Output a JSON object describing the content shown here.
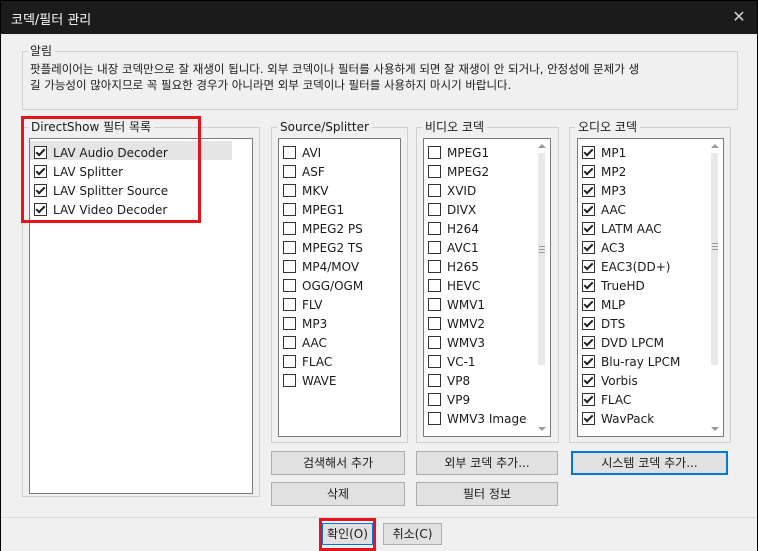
{
  "window": {
    "title": "코덱/필터 관리",
    "close_glyph": "✕"
  },
  "notice": {
    "label": "알림",
    "line1": "팟플레이어는 내장 코덱만으로 잘 재생이 됩니다. 외부 코덱이나 필터를 사용하게 되면 잘 재생이 안 되거나, 안정성에 문제가 생",
    "line2": "길 가능성이 많아지므로 꼭 필요한 경우가 아니라면 외부 코덱이나 필터를 사용하지 마시기 바랍니다."
  },
  "directshow": {
    "label": "DirectShow 필터 목록",
    "items": [
      {
        "label": "LAV Audio Decoder",
        "checked": true
      },
      {
        "label": "LAV Splitter",
        "checked": true
      },
      {
        "label": "LAV Splitter Source",
        "checked": true
      },
      {
        "label": "LAV Video Decoder",
        "checked": true
      }
    ]
  },
  "source": {
    "label": "Source/Splitter",
    "items": [
      {
        "label": "AVI",
        "checked": false
      },
      {
        "label": "ASF",
        "checked": false
      },
      {
        "label": "MKV",
        "checked": false
      },
      {
        "label": "MPEG1",
        "checked": false
      },
      {
        "label": "MPEG2 PS",
        "checked": false
      },
      {
        "label": "MPEG2 TS",
        "checked": false
      },
      {
        "label": "MP4/MOV",
        "checked": false
      },
      {
        "label": "OGG/OGM",
        "checked": false
      },
      {
        "label": "FLV",
        "checked": false
      },
      {
        "label": "MP3",
        "checked": false
      },
      {
        "label": "AAC",
        "checked": false
      },
      {
        "label": "FLAC",
        "checked": false
      },
      {
        "label": "WAVE",
        "checked": false
      }
    ]
  },
  "video": {
    "label": "비디오 코덱",
    "items": [
      {
        "label": "MPEG1",
        "checked": false
      },
      {
        "label": "MPEG2",
        "checked": false
      },
      {
        "label": "XVID",
        "checked": false
      },
      {
        "label": "DIVX",
        "checked": false
      },
      {
        "label": "H264",
        "checked": false
      },
      {
        "label": "AVC1",
        "checked": false
      },
      {
        "label": "H265",
        "checked": false
      },
      {
        "label": "HEVC",
        "checked": false
      },
      {
        "label": "WMV1",
        "checked": false
      },
      {
        "label": "WMV2",
        "checked": false
      },
      {
        "label": "WMV3",
        "checked": false
      },
      {
        "label": "VC-1",
        "checked": false
      },
      {
        "label": "VP8",
        "checked": false
      },
      {
        "label": "VP9",
        "checked": false
      },
      {
        "label": "WMV3 Image",
        "checked": false
      }
    ]
  },
  "audio": {
    "label": "오디오 코덱",
    "items": [
      {
        "label": "MP1",
        "checked": true
      },
      {
        "label": "MP2",
        "checked": true
      },
      {
        "label": "MP3",
        "checked": true
      },
      {
        "label": "AAC",
        "checked": true
      },
      {
        "label": "LATM AAC",
        "checked": true
      },
      {
        "label": "AC3",
        "checked": true
      },
      {
        "label": "EAC3(DD+)",
        "checked": true
      },
      {
        "label": "TrueHD",
        "checked": true
      },
      {
        "label": "MLP",
        "checked": true
      },
      {
        "label": "DTS",
        "checked": true
      },
      {
        "label": "DVD LPCM",
        "checked": true
      },
      {
        "label": "Blu-ray LPCM",
        "checked": true
      },
      {
        "label": "Vorbis",
        "checked": true
      },
      {
        "label": "FLAC",
        "checked": true
      },
      {
        "label": "WavPack",
        "checked": true
      }
    ]
  },
  "buttons": {
    "search_add": "검색해서 추가",
    "external_add": "외부 코덱 추가...",
    "system_add": "시스템 코덱 추가...",
    "delete": "삭제",
    "filter_info": "필터 정보",
    "ok": "확인(O)",
    "cancel": "취소(C)"
  },
  "colors": {
    "highlight": "#e3141c",
    "titlebar": "#1b1b1b"
  }
}
